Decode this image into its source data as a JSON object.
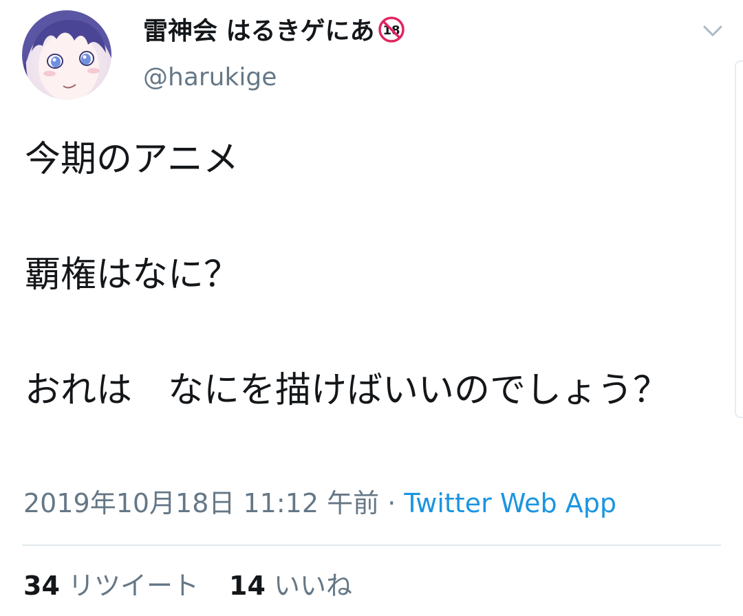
{
  "tweet": {
    "author": {
      "display_name": "雷神会 はるきゲにあ",
      "badge_icon": "no-under-18-icon",
      "handle": "@harukige",
      "avatar_icon": "anime-girl-avatar"
    },
    "menu_icon": "chevron-down-icon",
    "text": {
      "line1": "今期のアニメ",
      "line2": "覇権はなに？",
      "line3": "おれは　なにを描けばいいのでしょう？"
    },
    "timestamp": "2019年10月18日 11:12 午前",
    "separator": "·",
    "source": "Twitter Web App",
    "stats": {
      "retweets_count": "34",
      "retweets_label": "リツイート",
      "likes_count": "14",
      "likes_label": "いいね"
    }
  },
  "colors": {
    "text": "#14171a",
    "secondary": "#657786",
    "link": "#1b95e0",
    "divider": "#e1e8ed",
    "badge": "#e0245e"
  }
}
